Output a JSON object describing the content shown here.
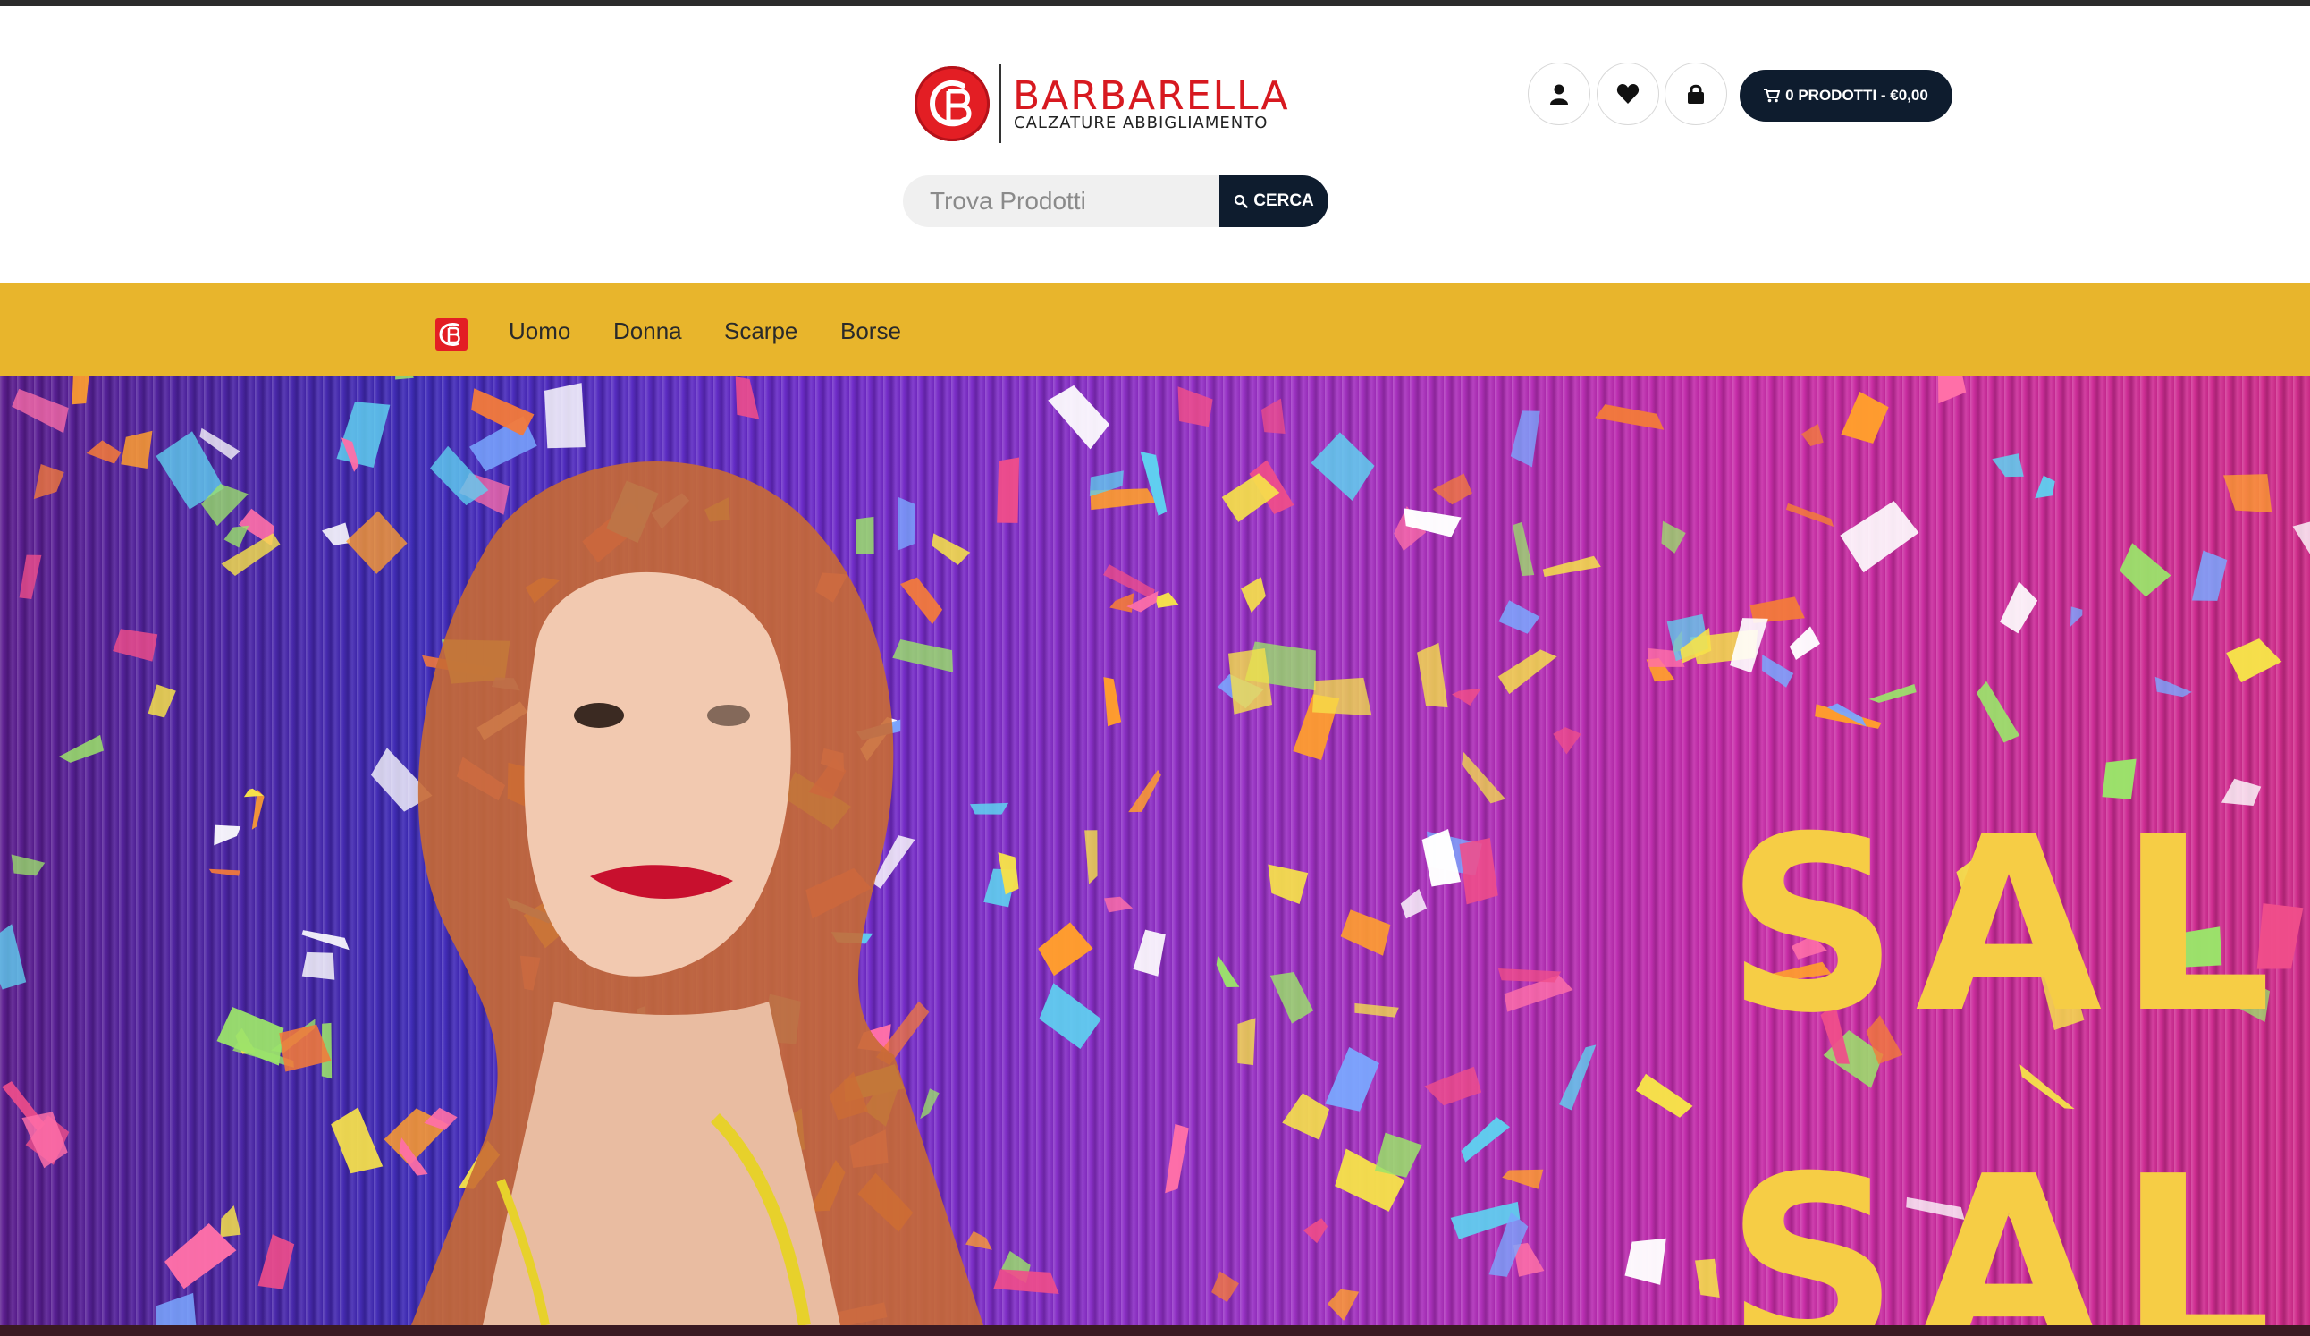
{
  "brand": {
    "name": "BARBARELLA",
    "tagline": "CALZATURE ABBIGLIAMENTO",
    "color": "#d71920"
  },
  "search": {
    "placeholder": "Trova Prodotti",
    "button_label": "CERCA"
  },
  "header": {
    "account_icon": "user-icon",
    "wishlist_icon": "heart-icon",
    "login_icon": "lock-icon",
    "cart_label": "0 PRODOTTI - €0,00"
  },
  "nav": {
    "items": [
      {
        "label": "Uomo"
      },
      {
        "label": "Donna"
      },
      {
        "label": "Scarpe"
      },
      {
        "label": "Borse"
      }
    ],
    "background": "#e8b52c"
  },
  "hero": {
    "line1": "SAL",
    "line2": "SAL",
    "text_color": "#f6cd45"
  },
  "colors": {
    "dark_button": "#0e1c2e",
    "accent_red": "#e31e24"
  }
}
